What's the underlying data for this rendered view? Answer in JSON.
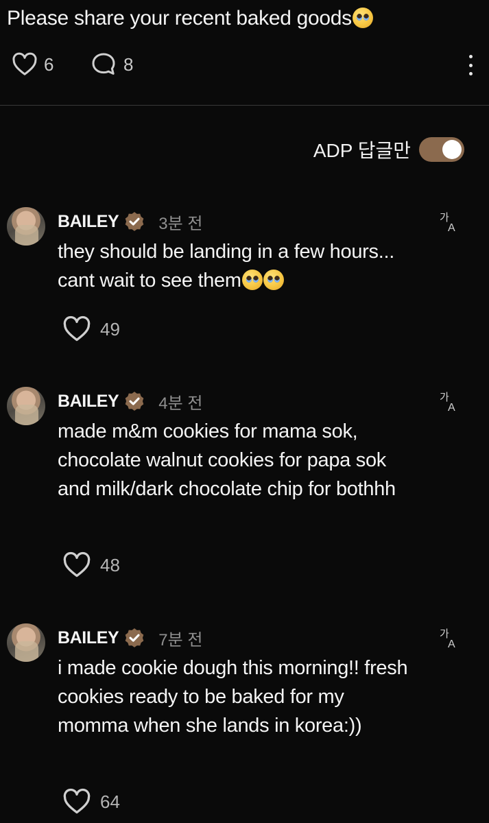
{
  "post": {
    "title": "Please share your recent baked goods",
    "title_emoji": "pleading-face-emoji",
    "likes": "6",
    "comments": "8"
  },
  "filter": {
    "label": "ADP 답글만",
    "toggle_on": true,
    "accent_color": "#8b6a4e"
  },
  "comments": [
    {
      "username": "BAILEY",
      "time": "3분 전",
      "text": "they should be landing in a few hours... cant wait to see them",
      "trailing_emoji": "pleading-face-emoji x2",
      "likes": "49"
    },
    {
      "username": "BAILEY",
      "time": "4분 전",
      "text": "made m&m cookies for mama sok, chocolate walnut cookies for papa sok and milk/dark chocolate chip for bothhh",
      "likes": "48"
    },
    {
      "username": "BAILEY",
      "time": "7분 전",
      "text": "i made cookie dough this morning!! fresh cookies ready to be baked for my momma when she lands in korea:))",
      "likes": "64"
    }
  ],
  "translate": {
    "line1": "가",
    "line2": "A"
  }
}
